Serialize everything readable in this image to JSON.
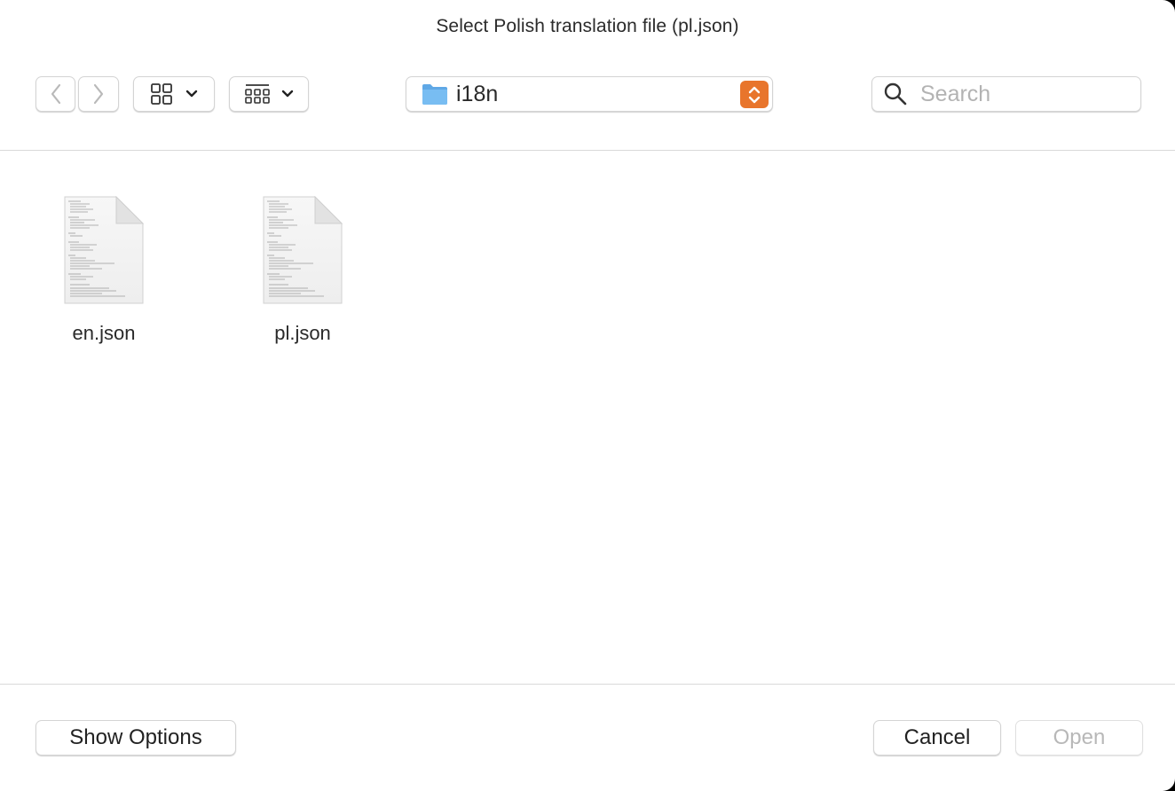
{
  "dialog": {
    "title": "Select Polish translation file (pl.json)"
  },
  "toolbar": {
    "back_icon": "chevron-left-icon",
    "forward_icon": "chevron-right-icon",
    "view_icons_icon": "grid-view-icon",
    "view_groups_icon": "group-view-icon",
    "location": {
      "label": "i18n",
      "icon": "folder-icon",
      "accent": "#e8752c"
    },
    "search": {
      "placeholder": "Search",
      "value": ""
    }
  },
  "files": [
    {
      "name": "en.json",
      "icon": "json-document-icon"
    },
    {
      "name": "pl.json",
      "icon": "json-document-icon"
    }
  ],
  "footer": {
    "show_options_label": "Show Options",
    "cancel_label": "Cancel",
    "open_label": "Open"
  }
}
